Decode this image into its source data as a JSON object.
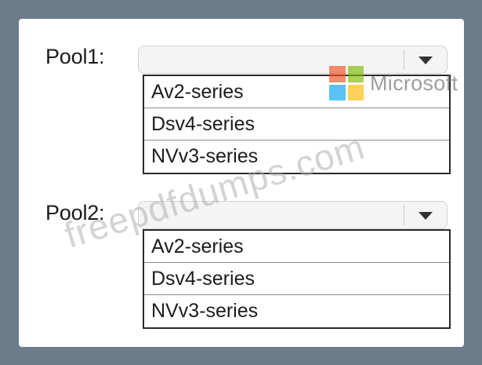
{
  "pools": [
    {
      "label": "Pool1:",
      "selected_value": "",
      "options": [
        "Av2-series",
        "Dsv4-series",
        "NVv3-series"
      ]
    },
    {
      "label": "Pool2:",
      "selected_value": "",
      "options": [
        "Av2-series",
        "Dsv4-series",
        "NVv3-series"
      ]
    }
  ],
  "logo": {
    "text": "Microsoft",
    "colors": [
      "#f25022",
      "#7fba00",
      "#00a4ef",
      "#ffb900"
    ]
  },
  "watermark": "freepdfdumps.com"
}
